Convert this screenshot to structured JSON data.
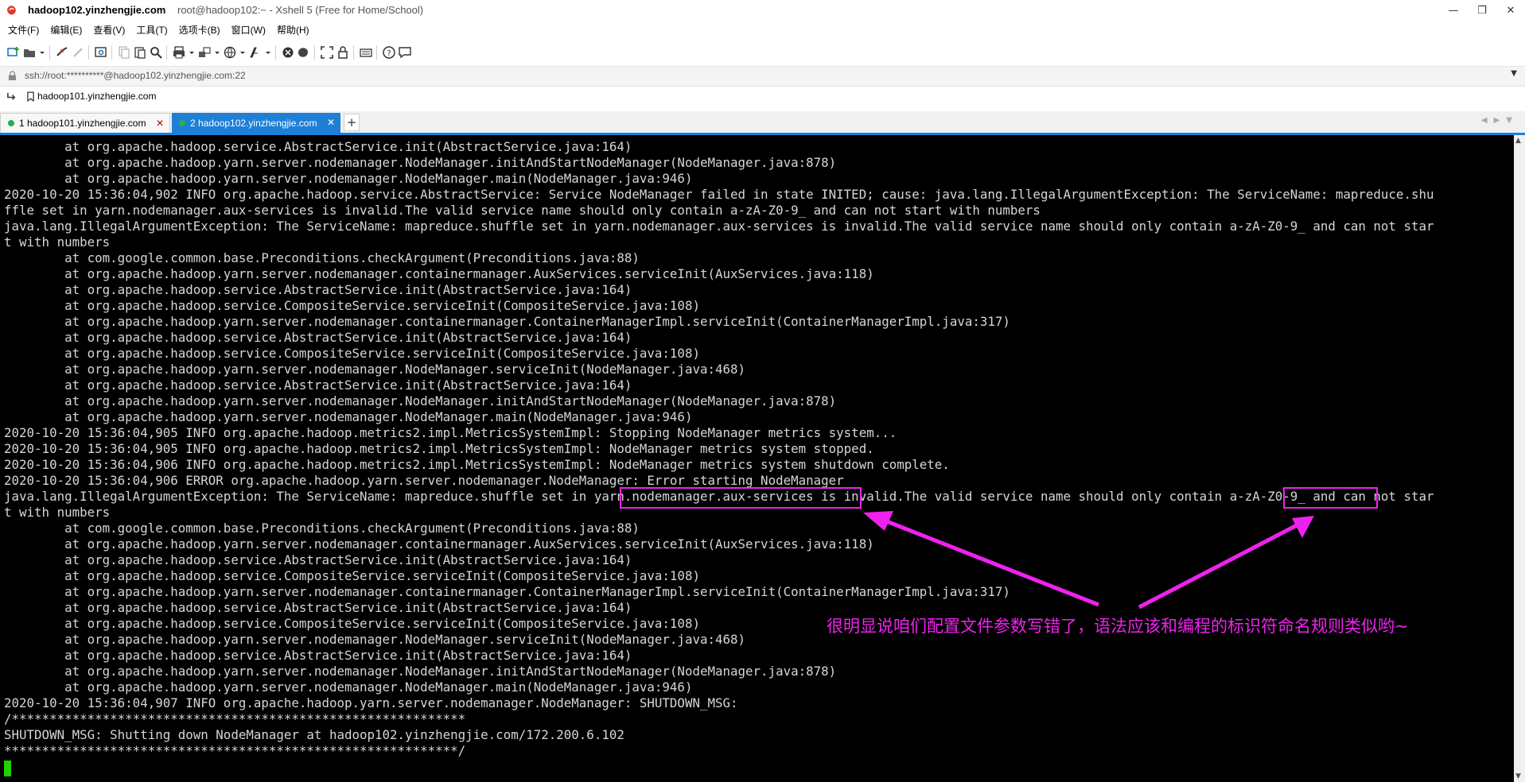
{
  "window": {
    "title_host": "hadoop102.yinzhengjie.com",
    "title_rest": "root@hadoop102:~ - Xshell 5 (Free for Home/School)"
  },
  "menu": [
    "文件(F)",
    "编辑(E)",
    "查看(V)",
    "工具(T)",
    "选项卡(B)",
    "窗口(W)",
    "帮助(H)"
  ],
  "address": {
    "text": "ssh://root:**********@hadoop102.yinzhengjie.com:22"
  },
  "links": {
    "bookmark": "hadoop101.yinzhengjie.com"
  },
  "tabs": [
    {
      "label": "1 hadoop101.yinzhengjie.com",
      "status_color": "#22b14c"
    },
    {
      "label": "2 hadoop102.yinzhengjie.com",
      "status_color": "#22b14c"
    }
  ],
  "terminal": {
    "lines": [
      "        at org.apache.hadoop.service.AbstractService.init(AbstractService.java:164)",
      "        at org.apache.hadoop.yarn.server.nodemanager.NodeManager.initAndStartNodeManager(NodeManager.java:878)",
      "        at org.apache.hadoop.yarn.server.nodemanager.NodeManager.main(NodeManager.java:946)",
      "2020-10-20 15:36:04,902 INFO org.apache.hadoop.service.AbstractService: Service NodeManager failed in state INITED; cause: java.lang.IllegalArgumentException: The ServiceName: mapreduce.shu",
      "ffle set in yarn.nodemanager.aux-services is invalid.The valid service name should only contain a-zA-Z0-9_ and can not start with numbers",
      "java.lang.IllegalArgumentException: The ServiceName: mapreduce.shuffle set in yarn.nodemanager.aux-services is invalid.The valid service name should only contain a-zA-Z0-9_ and can not star",
      "t with numbers",
      "        at com.google.common.base.Preconditions.checkArgument(Preconditions.java:88)",
      "        at org.apache.hadoop.yarn.server.nodemanager.containermanager.AuxServices.serviceInit(AuxServices.java:118)",
      "        at org.apache.hadoop.service.AbstractService.init(AbstractService.java:164)",
      "        at org.apache.hadoop.service.CompositeService.serviceInit(CompositeService.java:108)",
      "        at org.apache.hadoop.yarn.server.nodemanager.containermanager.ContainerManagerImpl.serviceInit(ContainerManagerImpl.java:317)",
      "        at org.apache.hadoop.service.AbstractService.init(AbstractService.java:164)",
      "        at org.apache.hadoop.service.CompositeService.serviceInit(CompositeService.java:108)",
      "        at org.apache.hadoop.yarn.server.nodemanager.NodeManager.serviceInit(NodeManager.java:468)",
      "        at org.apache.hadoop.service.AbstractService.init(AbstractService.java:164)",
      "        at org.apache.hadoop.yarn.server.nodemanager.NodeManager.initAndStartNodeManager(NodeManager.java:878)",
      "        at org.apache.hadoop.yarn.server.nodemanager.NodeManager.main(NodeManager.java:946)",
      "2020-10-20 15:36:04,905 INFO org.apache.hadoop.metrics2.impl.MetricsSystemImpl: Stopping NodeManager metrics system...",
      "2020-10-20 15:36:04,905 INFO org.apache.hadoop.metrics2.impl.MetricsSystemImpl: NodeManager metrics system stopped.",
      "2020-10-20 15:36:04,906 INFO org.apache.hadoop.metrics2.impl.MetricsSystemImpl: NodeManager metrics system shutdown complete.",
      "2020-10-20 15:36:04,906 ERROR org.apache.hadoop.yarn.server.nodemanager.NodeManager: Error starting NodeManager",
      "java.lang.IllegalArgumentException: The ServiceName: mapreduce.shuffle set in yarn.nodemanager.aux-services is invalid.The valid service name should only contain a-zA-Z0-9_ and can not star",
      "t with numbers",
      "        at com.google.common.base.Preconditions.checkArgument(Preconditions.java:88)",
      "        at org.apache.hadoop.yarn.server.nodemanager.containermanager.AuxServices.serviceInit(AuxServices.java:118)",
      "        at org.apache.hadoop.service.AbstractService.init(AbstractService.java:164)",
      "        at org.apache.hadoop.service.CompositeService.serviceInit(CompositeService.java:108)",
      "        at org.apache.hadoop.yarn.server.nodemanager.containermanager.ContainerManagerImpl.serviceInit(ContainerManagerImpl.java:317)",
      "        at org.apache.hadoop.service.AbstractService.init(AbstractService.java:164)",
      "        at org.apache.hadoop.service.CompositeService.serviceInit(CompositeService.java:108)",
      "        at org.apache.hadoop.yarn.server.nodemanager.NodeManager.serviceInit(NodeManager.java:468)",
      "        at org.apache.hadoop.service.AbstractService.init(AbstractService.java:164)",
      "        at org.apache.hadoop.yarn.server.nodemanager.NodeManager.initAndStartNodeManager(NodeManager.java:878)",
      "        at org.apache.hadoop.yarn.server.nodemanager.NodeManager.main(NodeManager.java:946)",
      "2020-10-20 15:36:04,907 INFO org.apache.hadoop.yarn.server.nodemanager.NodeManager: SHUTDOWN_MSG:",
      "/************************************************************",
      "SHUTDOWN_MSG: Shutting down NodeManager at hadoop102.yinzhengjie.com/172.200.6.102",
      "************************************************************/"
    ],
    "text_color": "#d6d6d6",
    "background": "#000000",
    "cursor_color": "#22d000"
  },
  "annotation": {
    "text": "很明显说咱们配置文件参数写错了，语法应该和编程的标识符命名规则类似哟~",
    "color": "#ee22ee"
  },
  "colors": {
    "active_tab": "#1e7fd6",
    "connected_dot": "#22b14c"
  }
}
